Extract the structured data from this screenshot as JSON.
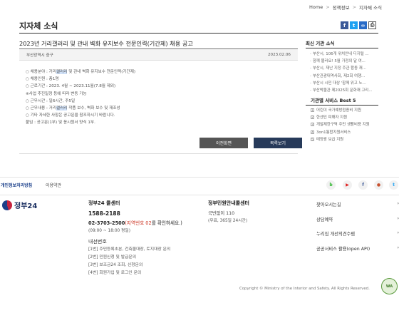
{
  "breadcrumb": {
    "home": "Home",
    "sep": ">",
    "policy": "정책정보",
    "current": "지자체 소식"
  },
  "page": {
    "title": "지자체 소식"
  },
  "article": {
    "title": "2023년 거리갤러리 및 관내 벽화 유지보수 전문인력(기간제) 채용 공고",
    "org": "부산광역시 중구",
    "date": "2023.02.06",
    "lines": [
      {
        "pre": "○ 채용분야 : 거리",
        "hl": "갤러리",
        "post": " 및 관내 벽화 유지보수 전문인력(기간제)"
      },
      {
        "pre": "○ 채용인원 : 총1명",
        "hl": "",
        "post": ""
      },
      {
        "pre": "○ 근로기간 : 2023. 4월 ~ 2023.11월(7.8월 제외)",
        "hl": "",
        "post": ""
      },
      {
        "pre": "※사업 추진일정 등에 따라 변동 가능",
        "hl": "",
        "post": ""
      },
      {
        "pre": "○ 근무시간 : 일6시간, 주5일",
        "hl": "",
        "post": ""
      },
      {
        "pre": "○ 근무내용 : 거리",
        "hl": "갤러리",
        "post": " 작품 보수, 벽화 보수 및 재조성"
      },
      {
        "pre": "○ 기타 자세한 사항은 공고문을 참조하시기 바랍니다.",
        "hl": "",
        "post": ""
      },
      {
        "pre": "붙임 : 공고문(1부) 및 응시원서 양식 1부.",
        "hl": "",
        "post": ""
      }
    ],
    "btn_prev": "이전화면",
    "btn_list": "목록보기"
  },
  "sidebar": {
    "latest_heading": "최신 기관 소식",
    "latest": [
      "부산시, 106개 위치안내 디지털 ...",
      "함께 불러요! 5월 가정의 달 여...",
      "부산시, 재난 지정 주관 합동 재...",
      "부산관광대역사회, 제2회 여행...",
      "부산시 시민 대상 '함께 위고 노...",
      "부산박물관 제2025회 문화재 고리..."
    ],
    "best_heading": "기관별 서비스 Best 5",
    "best": [
      "어린이 국가예방접종비 지원",
      "한센인 피해자 지원",
      "개발제한구역 주민 생활비용 지원",
      "3on1통합지원서비스",
      "태양광 보급 지원"
    ]
  },
  "footer": {
    "privacy": "개인정보처리방침",
    "terms": "이용약관",
    "sns": [
      "b",
      "▶",
      "f",
      "●",
      "t"
    ],
    "logo_text": "정부24",
    "hotline": {
      "heading": "정부24 콜센터",
      "number": "1588-2188",
      "alt_pre": "02-3703-2500",
      "alt_red": "(지역번호 02",
      "alt_post": "를 확인하세요.)",
      "hours": "(09:00 ~ 18:00 평일)",
      "ext_heading": "내선번호",
      "ext": [
        "[1번] 주민등록초본, 건축물대장, 토지대장 문의",
        "[2번] 민원신청 및 발급문의",
        "[3번] 보조금24 조회, 신청문의",
        "[4번] 회원가입 및 로그인 문의"
      ]
    },
    "center": {
      "heading": "정부민원안내콜센터",
      "number": "국번없이 110",
      "hours": "(무료, 365일 24시간)"
    },
    "links": [
      "찾아오시는길",
      "상담예약",
      "누리집 개선의견수렴",
      "공공서비스 활용(open API)"
    ],
    "copyright": "Copyright © Ministry of the Interior and Safety. All Rights Reserved.",
    "wa_mark": "WA"
  }
}
